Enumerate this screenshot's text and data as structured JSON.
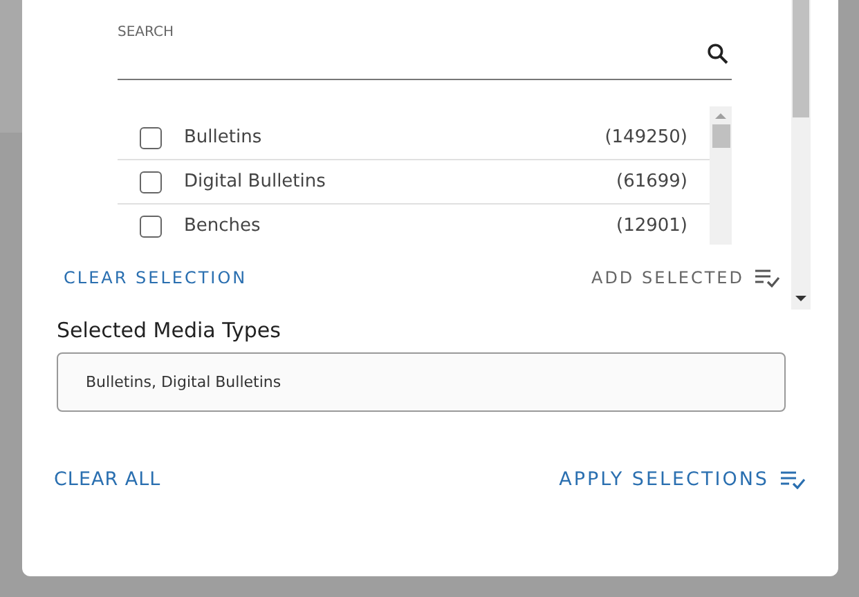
{
  "search": {
    "label": "SEARCH"
  },
  "media_types": [
    {
      "name": "Bulletins",
      "count": "(149250)",
      "checked": false
    },
    {
      "name": "Digital Bulletins",
      "count": "(61699)",
      "checked": false
    },
    {
      "name": "Benches",
      "count": "(12901)",
      "checked": false
    }
  ],
  "clear_selection": "CLEAR SELECTION",
  "add_selected": "ADD SELECTED",
  "selected_label": "Selected Media Types",
  "selected_value": "Bulletins, Digital Bulletins",
  "clear_all": "CLEAR ALL",
  "apply_selections": "APPLY SELECTIONS"
}
